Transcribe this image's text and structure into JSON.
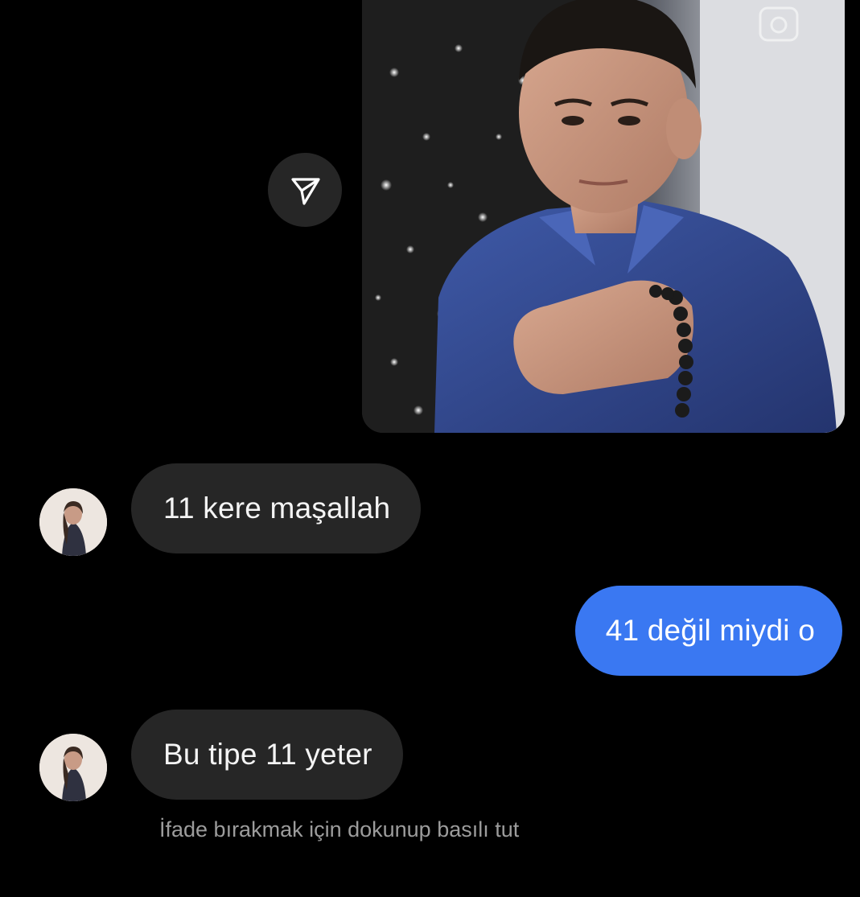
{
  "shared_post": {
    "image": "photo-of-young-man-in-blue-shirt-holding-prayer-beads",
    "corner_icon": "camera-icon"
  },
  "share_button": {
    "icon": "paper-plane-icon"
  },
  "messages": [
    {
      "side": "incoming",
      "avatar": "avatar",
      "text": "11 kere maşallah"
    },
    {
      "side": "outgoing",
      "text": "41 değil miydi o"
    },
    {
      "side": "incoming",
      "avatar": "avatar",
      "text": "Bu tipe 11 yeter"
    }
  ],
  "hint": "İfade bırakmak için dokunup basılı tut",
  "colors": {
    "background": "#000000",
    "incoming_bubble": "#262626",
    "outgoing_bubble": "#3a78f2",
    "hint_text": "#9c9c9c"
  }
}
